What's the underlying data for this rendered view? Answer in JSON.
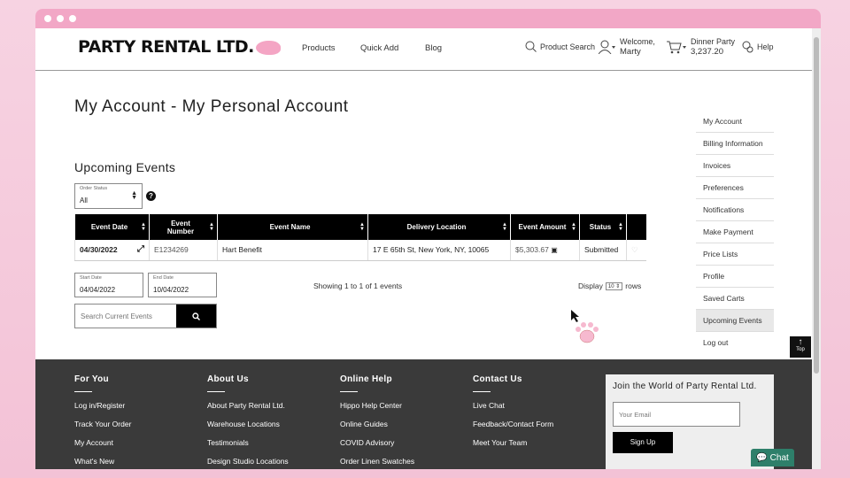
{
  "header": {
    "logo": "PARTY RENTAL LTD.",
    "nav": [
      "Products",
      "Quick Add",
      "Blog"
    ],
    "search_label": "Product Search",
    "welcome_line1": "Welcome,",
    "welcome_line2": "Marty",
    "cart_line1": "Dinner Party",
    "cart_line2": "3,237.20",
    "help": "Help"
  },
  "page": {
    "title": "My Account - My Personal Account",
    "section_title": "Upcoming Events",
    "order_status_label": "Order Status",
    "order_status_value": "All",
    "help_glyph": "?"
  },
  "table": {
    "headers": [
      "Event Date",
      "Event Number",
      "Event Name",
      "Delivery Location",
      "Event Amount",
      "Status",
      ""
    ],
    "rows": [
      {
        "date": "04/30/2022",
        "number": "E1234269",
        "name": "Hart Benefit",
        "location": "17 E 65th St, New York, NY, 10065",
        "amount": "$5,303.67",
        "status": "Submitted"
      }
    ]
  },
  "filters": {
    "start_label": "Start Date",
    "start_value": "04/04/2022",
    "end_label": "End Date",
    "end_value": "10/04/2022",
    "search_placeholder": "Search Current Events",
    "showing": "Showing 1 to 1 of 1 events",
    "display_label": "Display",
    "display_value": "10",
    "rows_label": "rows"
  },
  "sidenav": [
    "My Account",
    "Billing Information",
    "Invoices",
    "Preferences",
    "Notifications",
    "Make Payment",
    "Price Lists",
    "Profile",
    "Saved Carts",
    "Upcoming Events",
    "Log out"
  ],
  "sidenav_active": "Upcoming Events",
  "totop": "Top",
  "footer": {
    "columns": [
      {
        "title": "For You",
        "links": [
          "Log in/Register",
          "Track Your Order",
          "My Account",
          "What's New"
        ]
      },
      {
        "title": "About Us",
        "links": [
          "About Party Rental Ltd.",
          "Warehouse Locations",
          "Testimonials",
          "Design Studio Locations"
        ]
      },
      {
        "title": "Online Help",
        "links": [
          "Hippo Help Center",
          "Online Guides",
          "COVID Advisory",
          "Order Linen Swatches"
        ]
      },
      {
        "title": "Contact Us",
        "links": [
          "Live Chat",
          "Feedback/Contact Form",
          "Meet Your Team"
        ]
      }
    ],
    "newsletter_title": "Join the World of Party Rental Ltd.",
    "email_placeholder": "Your Email",
    "signup": "Sign Up"
  },
  "chat": "Chat",
  "colors": {
    "accent_pink": "#f2a7c6",
    "footer_bg": "#3a3a3a",
    "chat_green": "#2e7f6a"
  }
}
